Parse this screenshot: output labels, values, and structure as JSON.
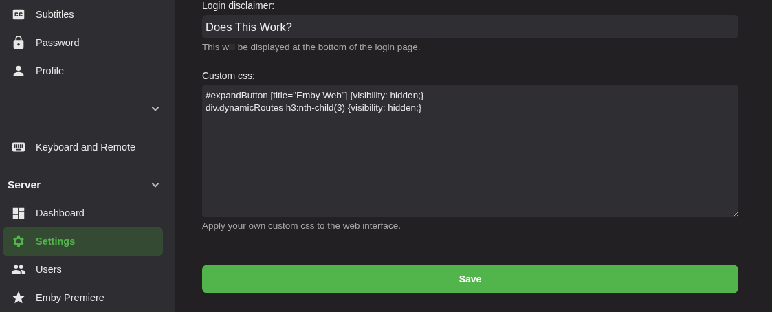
{
  "sidebar": {
    "entries": [
      {
        "kind": "item",
        "label": "Subtitles",
        "selected": false
      },
      {
        "kind": "item",
        "label": "Password",
        "selected": false
      },
      {
        "kind": "item",
        "label": "Profile",
        "selected": false
      },
      {
        "kind": "collapse",
        "expanded": false
      },
      {
        "kind": "item",
        "label": "Keyboard and Remote",
        "selected": false
      },
      {
        "kind": "header",
        "label": "Server",
        "expanded": false
      },
      {
        "kind": "item",
        "label": "Dashboard",
        "selected": false
      },
      {
        "kind": "item",
        "label": "Settings",
        "selected": true
      },
      {
        "kind": "item",
        "label": "Users",
        "selected": false
      },
      {
        "kind": "item",
        "label": "Emby Premiere",
        "selected": false
      }
    ]
  },
  "form": {
    "login_disclaimer": {
      "label": "Login disclaimer:",
      "value": "Does This Work?",
      "hint": "This will be displayed at the bottom of the login page."
    },
    "custom_css": {
      "label": "Custom css:",
      "value": "#expandButton [title=\"Emby Web\"] {visibility: hidden;}\ndiv.dynamicRoutes h3:nth-child(3) {visibility: hidden;}",
      "hint": "Apply your own custom css to the web interface."
    },
    "save_button": "Save"
  }
}
